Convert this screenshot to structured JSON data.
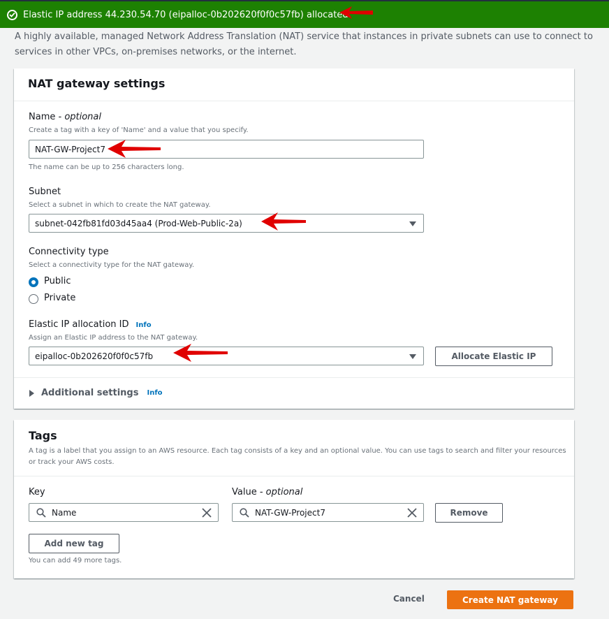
{
  "flash": {
    "message": "Elastic IP address 44.230.54.70 (eipalloc-0b202620f0f0c57fb) allocated."
  },
  "intro": {
    "text": "A highly available, managed Network Address Translation (NAT) service that instances in private subnets can use to connect to services in other VPCs, on-premises networks, or the internet."
  },
  "settings": {
    "title": "NAT gateway settings",
    "name": {
      "label": "Name - ",
      "optional": "optional",
      "description": "Create a tag with a key of 'Name' and a value that you specify.",
      "value": "NAT-GW-Project7",
      "constraint": "The name can be up to 256 characters long."
    },
    "subnet": {
      "label": "Subnet",
      "description": "Select a subnet in which to create the NAT gateway.",
      "value": "subnet-042fb81fd03d45aa4 (Prod-Web-Public-2a)"
    },
    "connectivity": {
      "label": "Connectivity type",
      "description": "Select a connectivity type for the NAT gateway.",
      "options": [
        "Public",
        "Private"
      ],
      "selected": "Public"
    },
    "eip": {
      "label": "Elastic IP allocation ID",
      "info": "Info",
      "description": "Assign an Elastic IP address to the NAT gateway.",
      "value": "eipalloc-0b202620f0f0c57fb",
      "allocate_button": "Allocate Elastic IP"
    },
    "additional": {
      "label": "Additional settings",
      "info": "Info"
    }
  },
  "tags": {
    "title": "Tags",
    "description": "A tag is a label that you assign to an AWS resource. Each tag consists of a key and an optional value. You can use tags to search and filter your resources or track your AWS costs.",
    "key_label": "Key",
    "value_label": "Value - ",
    "value_optional": "optional",
    "rows": [
      {
        "key": "Name",
        "value": "NAT-GW-Project7"
      }
    ],
    "remove_button": "Remove",
    "add_button": "Add new tag",
    "remaining": "You can add 49 more tags."
  },
  "footer": {
    "cancel": "Cancel",
    "create": "Create NAT gateway"
  },
  "colors": {
    "success": "#1d8102",
    "primary": "#ec7211",
    "link": "#0073bb",
    "annotation_arrow": "#e00000"
  },
  "icons": [
    "success-check-icon",
    "search-icon",
    "clear-icon",
    "caret-down-icon",
    "expand-triangle-icon",
    "annotation-arrow-icon"
  ]
}
